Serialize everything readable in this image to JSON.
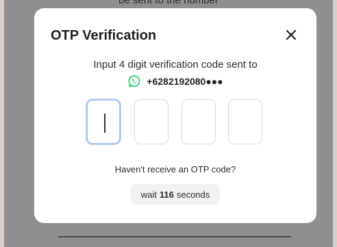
{
  "background": {
    "partial_text": "be sent to the number"
  },
  "modal": {
    "title": "OTP Verification",
    "close_icon": "close-icon",
    "instruction": "Input 4 digit verification code sent to",
    "phone_icon": "whatsapp-icon",
    "phone_number": "+6282192080●●●",
    "otp": {
      "digit_count": 4,
      "values": [
        "",
        "",
        "",
        ""
      ],
      "active_index": 0
    },
    "resend_question": "Haven't receive an OTP code?",
    "wait": {
      "prefix": "wait",
      "seconds": "116",
      "suffix": "seconds"
    }
  },
  "colors": {
    "overlay": "#8f8f8f",
    "modal_bg": "#ffffff",
    "active_border": "#a9c2ec",
    "whatsapp_green": "#25d366",
    "pill_bg": "#f1f1f1"
  }
}
